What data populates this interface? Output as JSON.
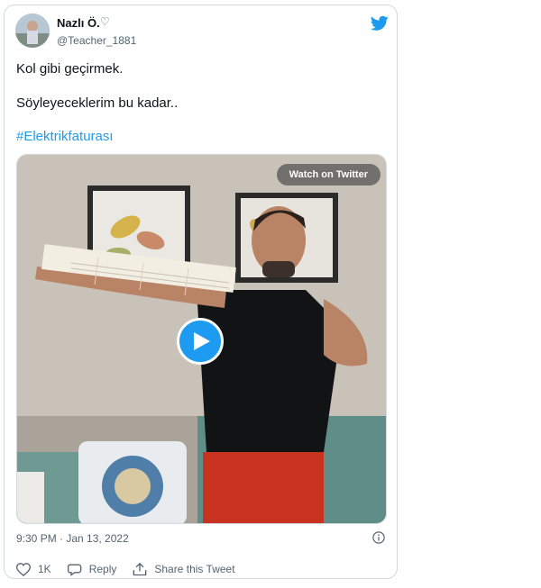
{
  "tweet": {
    "author_name": "Nazlı Ö.",
    "author_badge": "♡",
    "author_handle": "@Teacher_1881",
    "line1": "Kol gibi geçirmek.",
    "line2": "Söyleyeceklerim bu kadar..",
    "hashtag": "#Elektrikfaturası",
    "timestamp": "9:30 PM · Jan 13, 2022"
  },
  "media": {
    "watch_label": "Watch on Twitter",
    "play_icon": "play-icon"
  },
  "actions": {
    "like_count": "1K",
    "reply_label": "Reply",
    "share_label": "Share this Tweet"
  },
  "colors": {
    "accent": "#1d9bf0",
    "muted_text": "#536471",
    "border": "#cfd9de"
  }
}
